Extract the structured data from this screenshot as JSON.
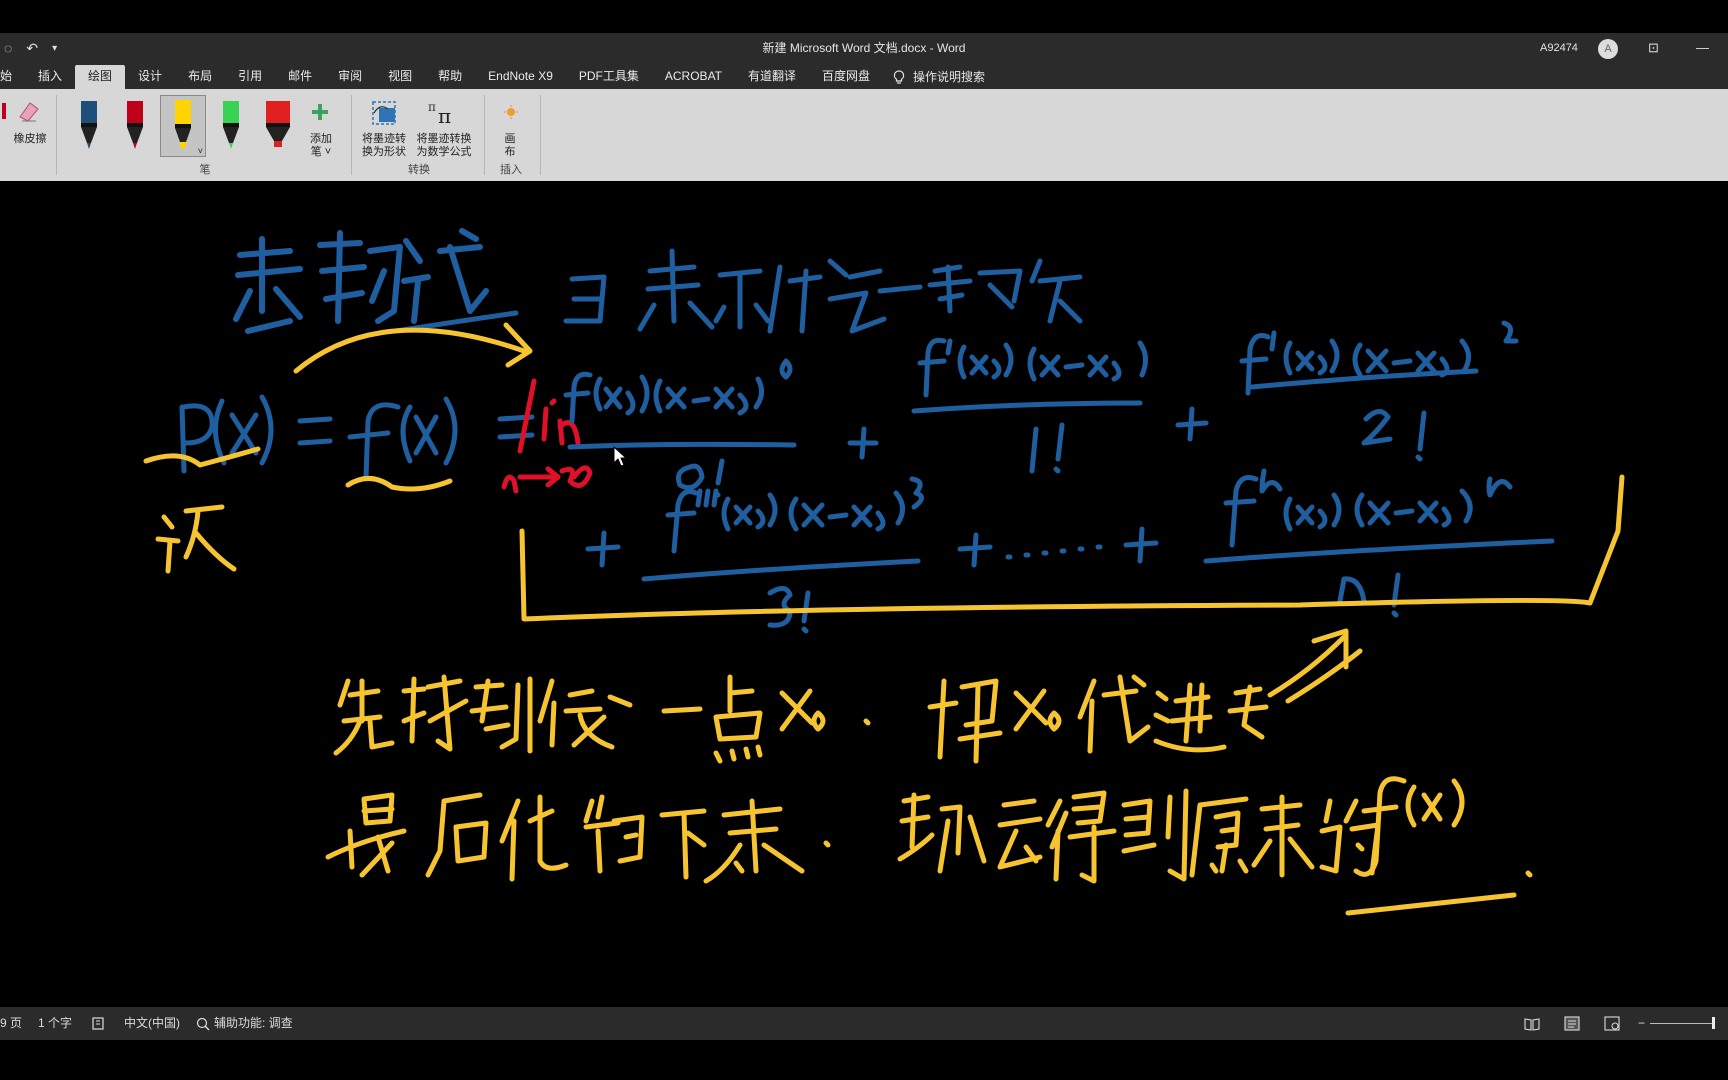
{
  "app": {
    "title": "新建 Microsoft Word 文档.docx  -  Word",
    "account": "A92474",
    "avatar_initial": "A"
  },
  "quick_access": {
    "undo_icon": "undo-icon",
    "dropdown_icon": "chevron-down-icon"
  },
  "window_controls": {
    "ribbon_display": "⊡",
    "minimize": "—"
  },
  "tabs": [
    {
      "label": "始"
    },
    {
      "label": "插入"
    },
    {
      "label": "绘图",
      "active": true
    },
    {
      "label": "设计"
    },
    {
      "label": "布局"
    },
    {
      "label": "引用"
    },
    {
      "label": "邮件"
    },
    {
      "label": "审阅"
    },
    {
      "label": "视图"
    },
    {
      "label": "帮助"
    },
    {
      "label": "EndNote X9"
    },
    {
      "label": "PDF工具集"
    },
    {
      "label": "ACROBAT"
    },
    {
      "label": "有道翻译"
    },
    {
      "label": "百度网盘"
    }
  ],
  "tell_me": {
    "label": "操作说明搜索",
    "icon": "lightbulb-icon"
  },
  "ribbon": {
    "eraser_label": "橡皮擦",
    "pens": [
      {
        "name": "pen-blue",
        "color": "#1f4e79"
      },
      {
        "name": "pen-red",
        "color": "#c00018"
      },
      {
        "name": "highlighter-yellow",
        "color": "#ffd400",
        "selected": true
      },
      {
        "name": "pen-green",
        "color": "#39d353"
      },
      {
        "name": "highlighter-red",
        "color": "#e02020"
      }
    ],
    "add_pen_label": "添加\n笔 ˅",
    "pens_group_label": "笔",
    "ink_to_shape_label": "将墨迹转\n换为形状",
    "ink_to_math_label": "将墨迹转换\n为数学公式",
    "convert_group_label": "转换",
    "canvas_label": "画\n布",
    "insert_group_label": "插入"
  },
  "status": {
    "page": "9 页",
    "words": "1 个字",
    "language": "中文(中国)",
    "accessibility": "辅助功能: 调查"
  },
  "ink_colors": {
    "blue": "#1f5fa0",
    "yellow": "#f6c431",
    "red": "#e0102a"
  }
}
